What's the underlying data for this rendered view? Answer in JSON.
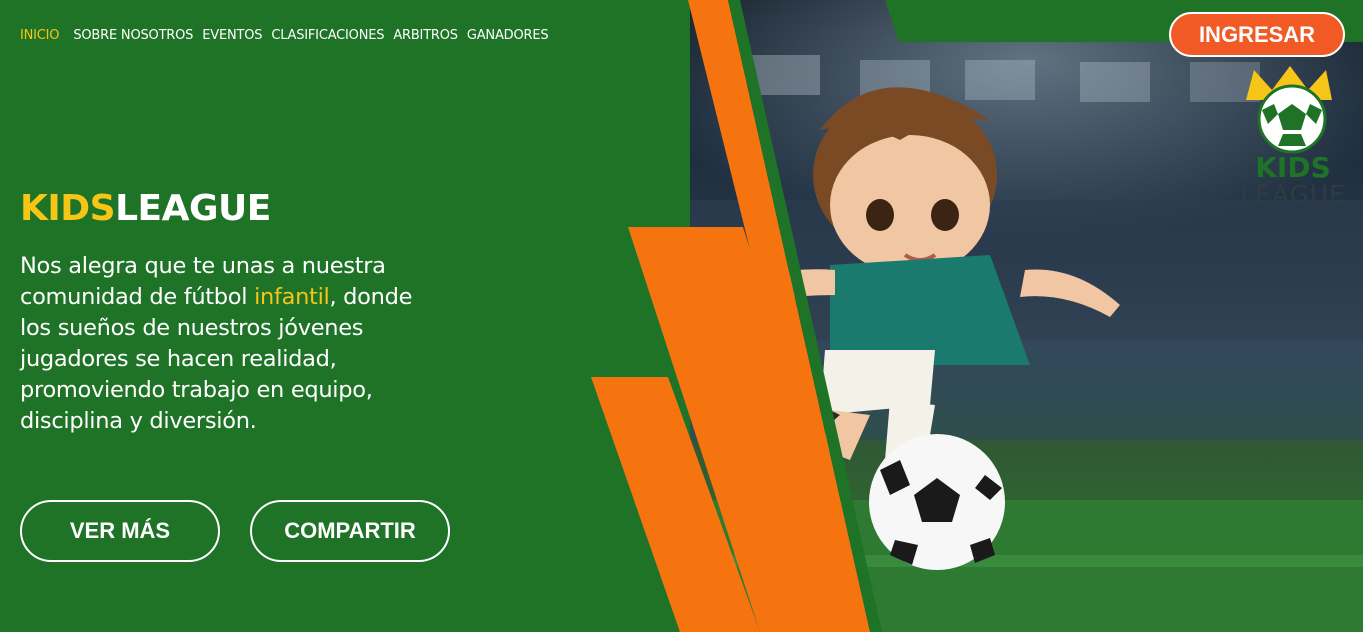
{
  "nav": {
    "items": [
      {
        "label": "INICIO",
        "active": true
      },
      {
        "label": "SOBRE NOSOTROS"
      },
      {
        "label": "EVENTOS"
      },
      {
        "label": "CLASIFICACIONES"
      },
      {
        "label": "ARBITROS"
      },
      {
        "label": "GANADORES"
      }
    ]
  },
  "header": {
    "login_label": "INGRESAR"
  },
  "logo": {
    "line1": "KIDS",
    "line2": "LEAGUE"
  },
  "hero": {
    "title_accent": "KIDS",
    "title_rest": "LEAGUE",
    "body_before": "Nos alegra que te unas a nuestra comunidad de fútbol ",
    "body_accent": "infantil",
    "body_after": ", donde los sueños de nuestros jóvenes jugadores se hacen realidad, promoviendo trabajo en equipo, disciplina y diversión.",
    "more_label": "VER MÁS",
    "share_label": "COMPARTIR"
  },
  "colors": {
    "background_green": "#1e7327",
    "accent_yellow": "#f5c518",
    "accent_orange": "#f15a24",
    "stripe_orange": "#f5740f"
  }
}
